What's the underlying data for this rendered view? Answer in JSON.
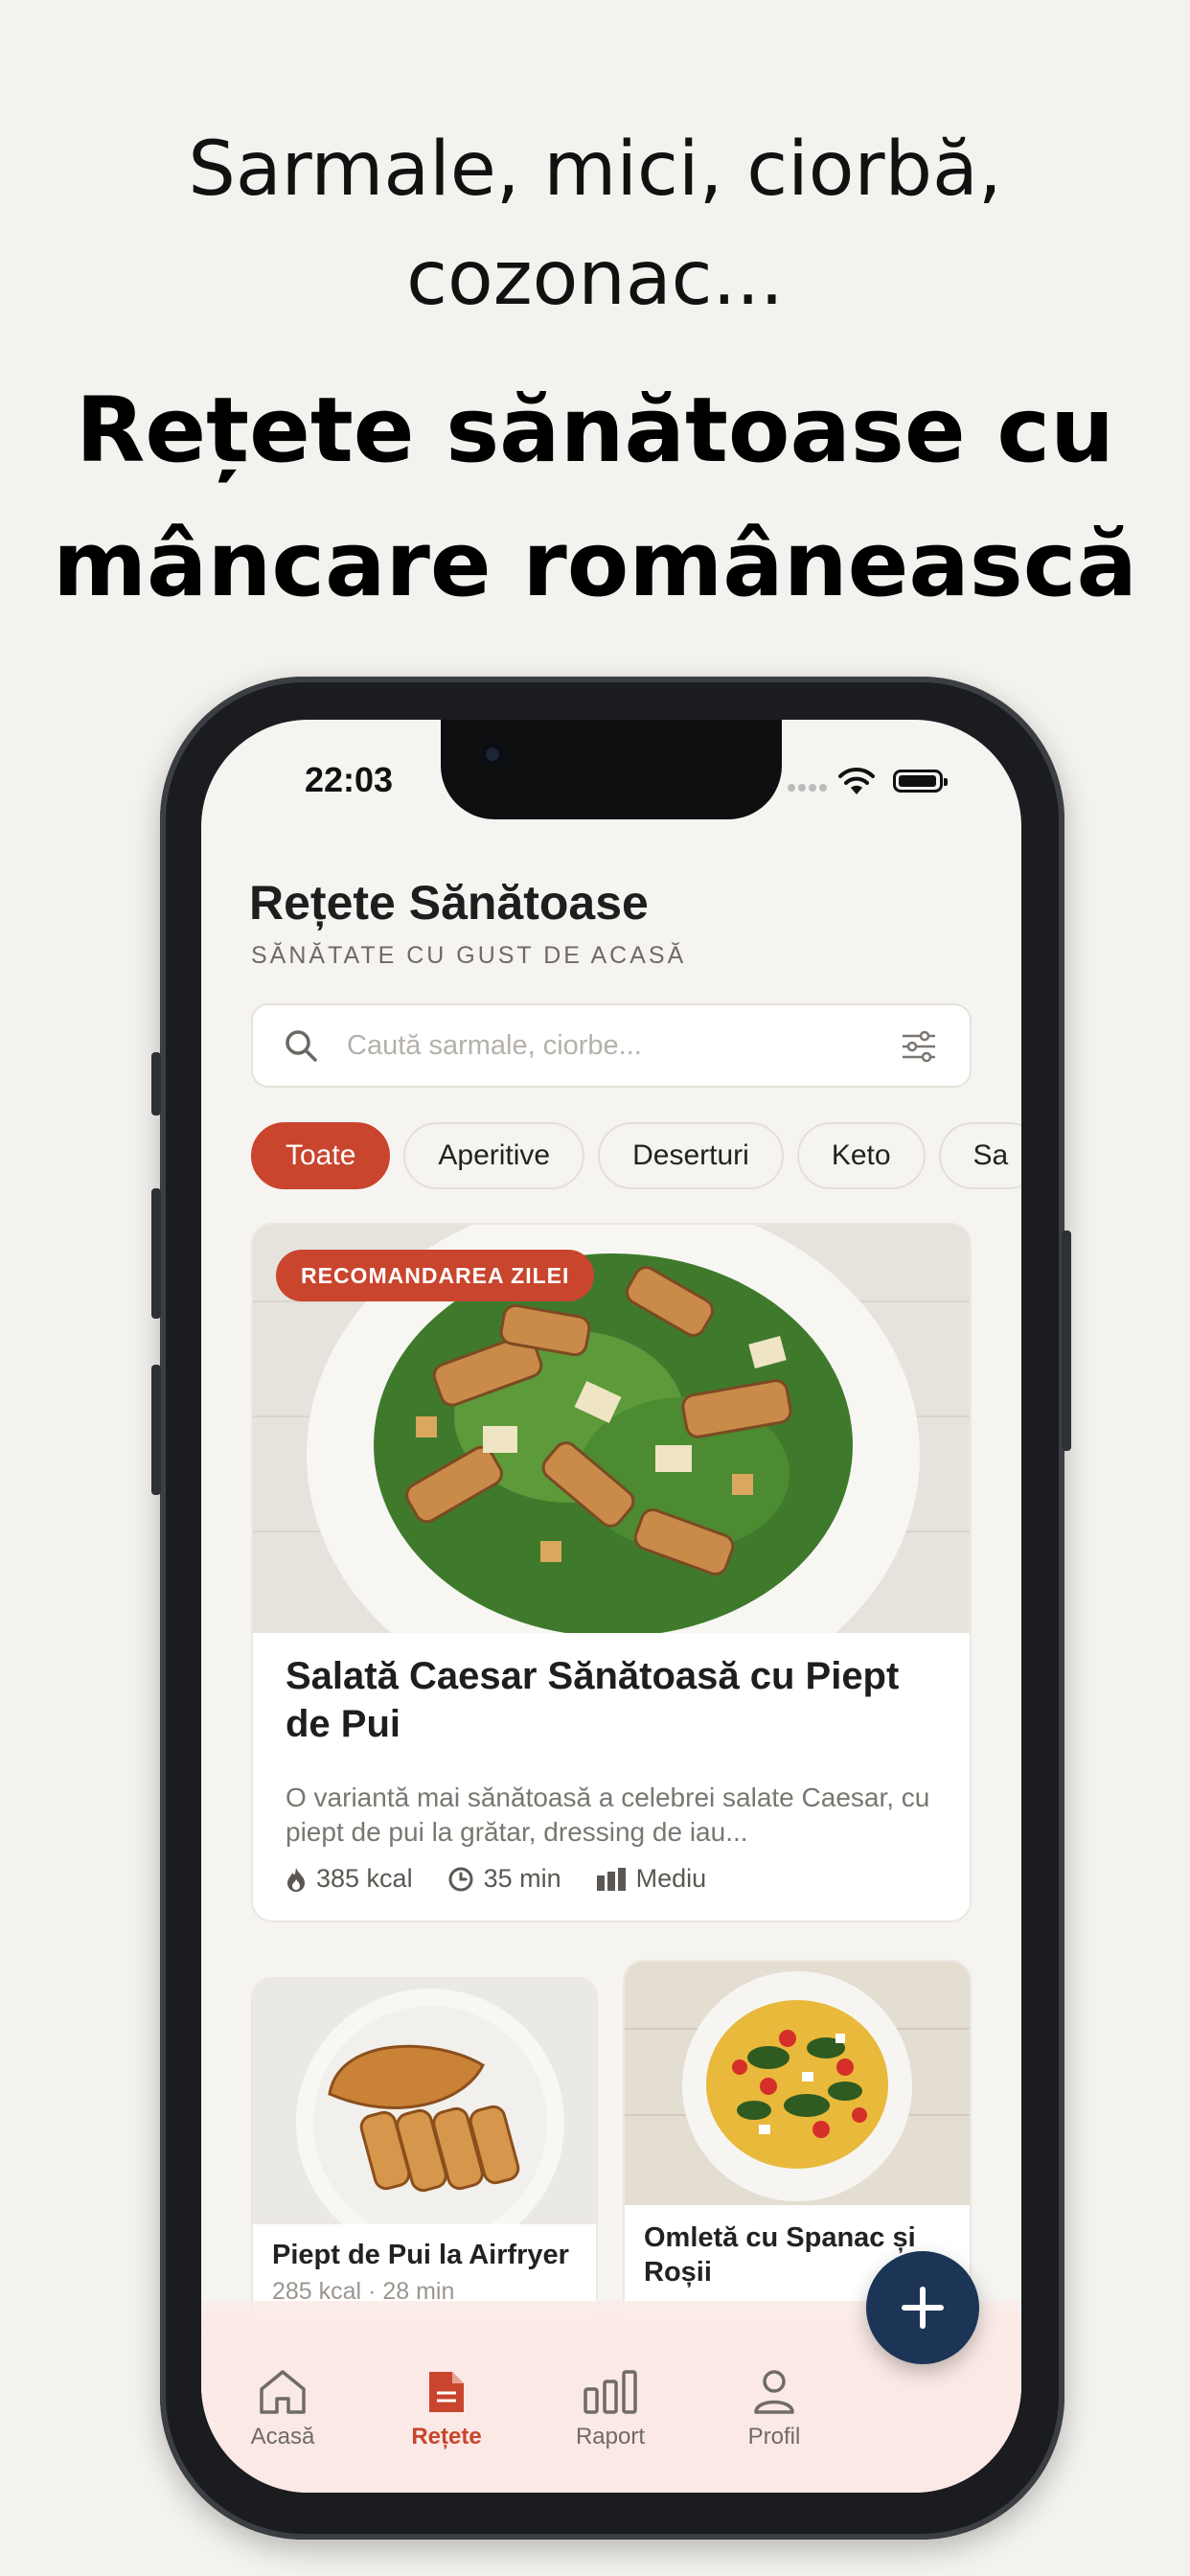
{
  "promo": {
    "tagline": "Sarmale, mici, ciorbă, cozonac...",
    "headline": "Rețete sănătoase cu mâncare românească"
  },
  "status_bar": {
    "time": "22:03"
  },
  "app": {
    "title": "Rețete Sănătoase",
    "subtitle": "SĂNĂTATE CU GUST DE ACASĂ"
  },
  "search": {
    "placeholder": "Caută sarmale, ciorbe..."
  },
  "categories": [
    "Toate",
    "Aperitive",
    "Deserturi",
    "Keto",
    "Sa"
  ],
  "featured": {
    "badge": "RECOMANDAREA ZILEI",
    "title": "Salată Caesar Sănătoasă cu Piept de Pui",
    "description": "O variantă mai sănătoasă a celebrei salate Caesar, cu piept de pui la grătar, dressing de iau...",
    "calories": "385 kcal",
    "time": "35 min",
    "difficulty": "Mediu"
  },
  "recipes": [
    {
      "title": "Piept de Pui la Airfryer",
      "meta": "285 kcal · 28 min"
    },
    {
      "title": "Omletă cu Spanac și Roșii"
    }
  ],
  "tabbar": [
    {
      "label": "Acasă",
      "icon": "home-icon"
    },
    {
      "label": "Rețete",
      "icon": "recipe-icon",
      "active": true
    },
    {
      "label": "Raport",
      "icon": "chart-icon"
    },
    {
      "label": "Profil",
      "icon": "profile-icon"
    }
  ],
  "colors": {
    "accent": "#c9452d",
    "fab": "#1c3557",
    "background": "#f4f2ee"
  }
}
